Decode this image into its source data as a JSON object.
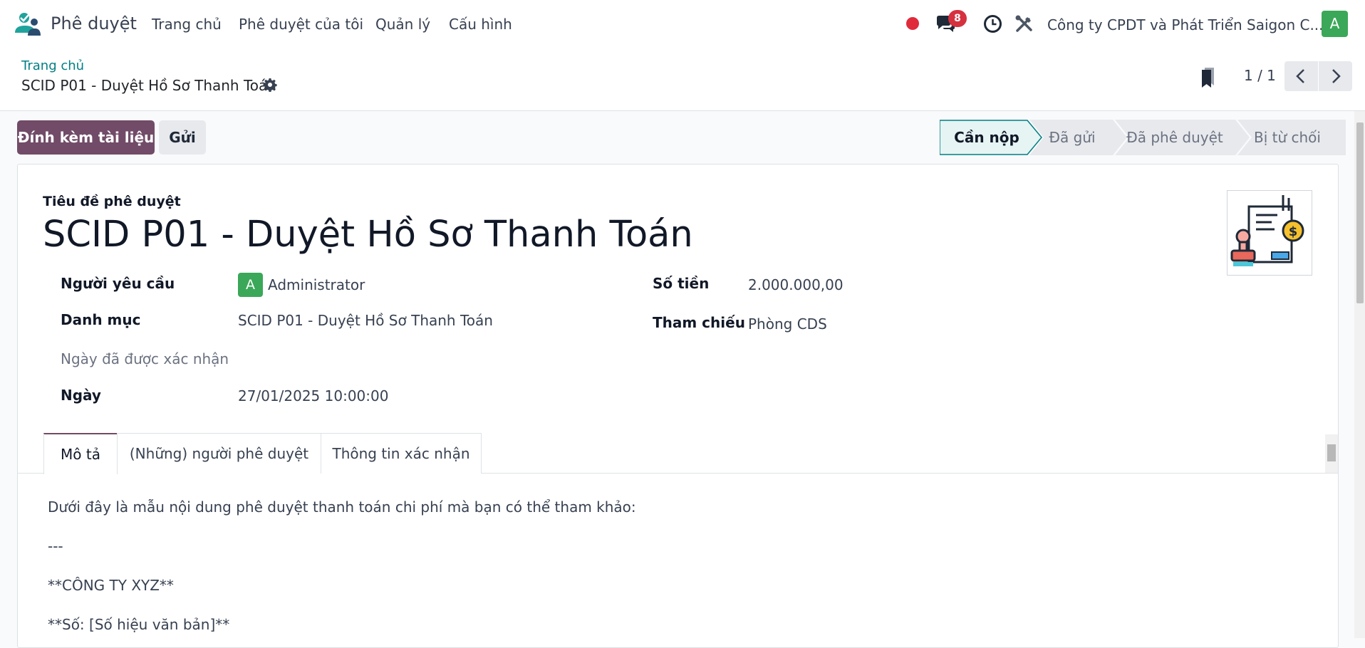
{
  "app": {
    "name": "Phê duyệt",
    "menu": [
      "Trang chủ",
      "Phê duyệt của tôi",
      "Quản lý",
      "Cấu hình"
    ],
    "chat_count": "8",
    "company": "Công ty CPDT và Phát Triển Saigon C...",
    "user_initial": "A"
  },
  "breadcrumb": {
    "parent": "Trang chủ",
    "current": "SCID P01 - Duyệt Hồ Sơ Thanh Toán"
  },
  "pager": {
    "text": "1 / 1"
  },
  "actions": {
    "attach_label": "Đính kèm tài liệu",
    "send_label": "Gửi"
  },
  "statusbar": {
    "stages": [
      "Cần nộp",
      "Đã gửi",
      "Đã phê duyệt",
      "Bị từ chối"
    ],
    "active_index": 0
  },
  "form": {
    "title_label": "Tiêu đề phê duyệt",
    "title": "SCID P01 - Duyệt Hồ Sơ Thanh Toán",
    "requester_label": "Người yêu cầu",
    "requester_initial": "A",
    "requester": "Administrator",
    "category_label": "Danh mục",
    "category": "SCID P01 - Duyệt Hồ Sơ Thanh Toán",
    "confirmed_date_label": "Ngày đã được xác nhận",
    "date_label": "Ngày",
    "date": "27/01/2025 10:00:00",
    "amount_label": "Số tiền",
    "amount": "2.000.000,00",
    "reference_label": "Tham chiếu",
    "reference": "Phòng CDS"
  },
  "tabs": [
    "Mô tả",
    "(Những) người phê duyệt",
    "Thông tin xác nhận"
  ],
  "description": [
    "Dưới đây là mẫu nội dung phê duyệt thanh toán chi phí mà bạn có thể tham khảo:",
    "---",
    "**CÔNG TY XYZ**",
    "**Số: [Số hiệu văn bản]**"
  ],
  "colors": {
    "primary": "#714b67",
    "link": "#017e84",
    "success": "#3aa858",
    "danger": "#d6313f"
  }
}
